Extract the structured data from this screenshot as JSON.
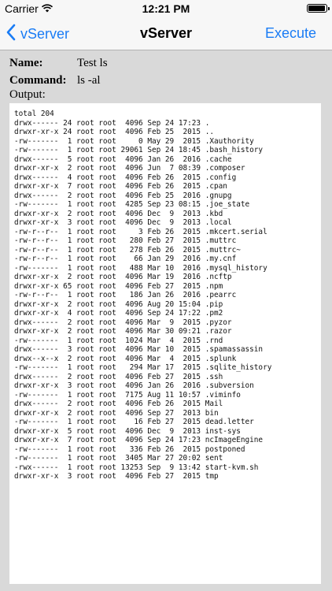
{
  "status_bar": {
    "carrier": "Carrier",
    "time": "12:21 PM",
    "wifi_icon": "wifi-icon",
    "battery_icon": "battery-icon"
  },
  "nav": {
    "back_label": "vServer",
    "title": "vServer",
    "execute_label": "Execute",
    "accent_color": "#1a7cf5"
  },
  "form": {
    "name_label": "Name:",
    "name_value": "Test ls",
    "command_label": "Command:",
    "command_value": "ls -al",
    "output_label": "Output:"
  },
  "output": {
    "lines": [
      "total 204",
      "drwx------ 24 root root  4096 Sep 24 17:23 .",
      "drwxr-xr-x 24 root root  4096 Feb 25  2015 ..",
      "-rw-------  1 root root     0 May 29  2015 .Xauthority",
      "-rw-------  1 root root 29061 Sep 24 18:45 .bash_history",
      "drwx------  5 root root  4096 Jan 26  2016 .cache",
      "drwxr-xr-x  2 root root  4096 Jun  7 08:39 .composer",
      "drwx------  4 root root  4096 Feb 26  2015 .config",
      "drwxr-xr-x  7 root root  4096 Feb 26  2015 .cpan",
      "drwx------  2 root root  4096 Feb 25  2016 .gnupg",
      "-rw-------  1 root root  4285 Sep 23 08:15 .joe_state",
      "drwxr-xr-x  2 root root  4096 Dec  9  2013 .kbd",
      "drwxr-xr-x  3 root root  4096 Dec  9  2013 .local",
      "-rw-r--r--  1 root root     3 Feb 26  2015 .mkcert.serial",
      "-rw-r--r--  1 root root   280 Feb 27  2015 .muttrc",
      "-rw-r--r--  1 root root   278 Feb 26  2015 .muttrc~",
      "-rw-r--r--  1 root root    66 Jan 29  2016 .my.cnf",
      "-rw-------  1 root root   488 Mar 10  2016 .mysql_history",
      "drwxr-xr-x  2 root root  4096 Mar 19  2016 .ncftp",
      "drwxr-xr-x 65 root root  4096 Feb 27  2015 .npm",
      "-rw-r--r--  1 root root   186 Jan 26  2016 .pearrc",
      "drwxr-xr-x  2 root root  4096 Aug 20 15:04 .pip",
      "drwxr-xr-x  4 root root  4096 Sep 24 17:22 .pm2",
      "drwx------  2 root root  4096 Mar  9  2015 .pyzor",
      "drwxr-xr-x  2 root root  4096 Mar 30 09:21 .razor",
      "-rw-------  1 root root  1024 Mar  4  2015 .rnd",
      "drwx------  3 root root  4096 Mar 10  2015 .spamassassin",
      "drwx--x--x  2 root root  4096 Mar  4  2015 .splunk",
      "-rw-------  1 root root   294 Mar 17  2015 .sqlite_history",
      "drwx------  2 root root  4096 Feb 27  2015 .ssh",
      "drwxr-xr-x  3 root root  4096 Jan 26  2016 .subversion",
      "-rw-------  1 root root  7175 Aug 11 10:57 .viminfo",
      "drwx------  2 root root  4096 Feb 26  2015 Mail",
      "drwxr-xr-x  2 root root  4096 Sep 27  2013 bin",
      "-rw-------  1 root root    16 Feb 27  2015 dead.letter",
      "drwxr-xr-x  5 root root  4096 Dec  9  2013 inst-sys",
      "drwxr-xr-x  7 root root  4096 Sep 24 17:23 ncImageEngine",
      "-rw-------  1 root root   336 Feb 26  2015 postponed",
      "-rw-------  1 root root  3405 Mar 27 20:02 sent",
      "-rwx------  1 root root 13253 Sep  9 13:42 start-kvm.sh",
      "drwxr-xr-x  3 root root  4096 Feb 27  2015 tmp"
    ]
  }
}
